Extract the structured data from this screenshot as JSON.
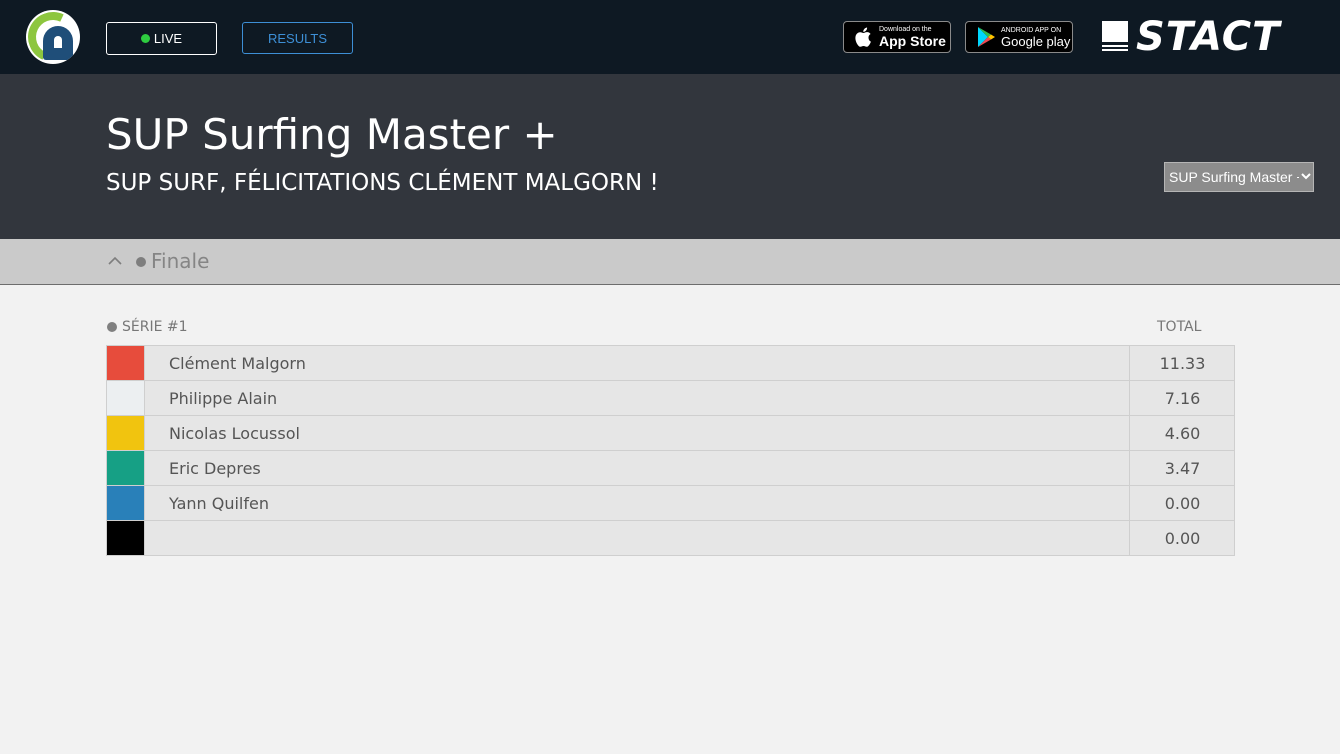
{
  "nav": {
    "live_label": "LIVE",
    "results_label": "RESULTS",
    "live_dot_color": "#2ecc40",
    "results_color": "#3d8fd6"
  },
  "stores": {
    "apple_small": "Download on the",
    "apple_big": "App Store",
    "google_small": "ANDROID APP ON",
    "google_big": "Google play"
  },
  "brand": {
    "name": "STACT"
  },
  "event": {
    "title": "SUP Surfing Master +",
    "subtitle": "SUP SURF, FÉLICITATIONS CLÉMENT MALGORN !",
    "select_value": "SUP Surfing Master +"
  },
  "round": {
    "label": "Finale"
  },
  "series": {
    "label": "SÉRIE #1",
    "total_label": "TOTAL",
    "rows": [
      {
        "color": "#e74c3c",
        "name": "Clément Malgorn",
        "score": "11.33"
      },
      {
        "color": "#eceff1",
        "name": "Philippe Alain",
        "score": "7.16"
      },
      {
        "color": "#f1c40f",
        "name": "Nicolas Locussol",
        "score": "4.60"
      },
      {
        "color": "#16a085",
        "name": "Eric Depres",
        "score": "3.47"
      },
      {
        "color": "#2980b9",
        "name": "Yann Quilfen",
        "score": "0.00"
      },
      {
        "color": "#000000",
        "name": "",
        "score": "0.00"
      }
    ]
  }
}
